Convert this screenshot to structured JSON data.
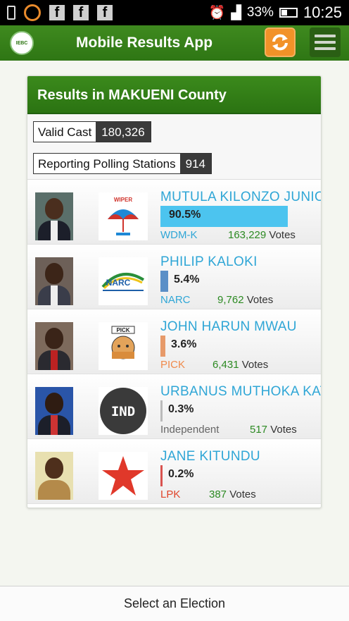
{
  "status_bar": {
    "battery": "33%",
    "time": "10:25"
  },
  "app": {
    "title": "Mobile Results App",
    "logo_text": "IEBC"
  },
  "card": {
    "title": "Results in MAKUENI County",
    "valid_cast_label": "Valid Cast",
    "valid_cast_value": "180,326",
    "reporting_label": "Reporting Polling Stations",
    "reporting_value": "914"
  },
  "candidates": [
    {
      "name": "MUTULA KILONZO JUNIOR",
      "percent": "90.5%",
      "percent_value": 90.5,
      "party": "WDM-K",
      "votes": "163,229",
      "votes_suffix": "Votes",
      "party_color": "#2fa6d6",
      "bar_color": "#4cc4ef"
    },
    {
      "name": "PHILIP KALOKI",
      "percent": "5.4%",
      "percent_value": 5.4,
      "party": "NARC",
      "votes": "9,762",
      "votes_suffix": "Votes",
      "party_color": "#2fa6d6",
      "bar_color": "#5b8fc7"
    },
    {
      "name": "JOHN HARUN MWAU",
      "percent": "3.6%",
      "percent_value": 3.6,
      "party": "PICK",
      "votes": "6,431",
      "votes_suffix": "Votes",
      "party_color": "#f08a4b",
      "bar_color": "#e79a6a"
    },
    {
      "name": "URBANUS MUTHOKA KATUMO",
      "percent": "0.3%",
      "percent_value": 0.3,
      "party": "Independent",
      "votes": "517",
      "votes_suffix": "Votes",
      "party_color": "#666666",
      "bar_color": "#bbbbbb"
    },
    {
      "name": "JANE KITUNDU",
      "percent": "0.2%",
      "percent_value": 0.2,
      "party": "LPK",
      "votes": "387",
      "votes_suffix": "Votes",
      "party_color": "#e0442a",
      "bar_color": "#d9534f"
    }
  ],
  "party_logos": {
    "wiper": "WIPER",
    "narc": "NARC",
    "pick": "PICK",
    "ind": "IND"
  },
  "bottom": {
    "label": "Select an Election"
  }
}
